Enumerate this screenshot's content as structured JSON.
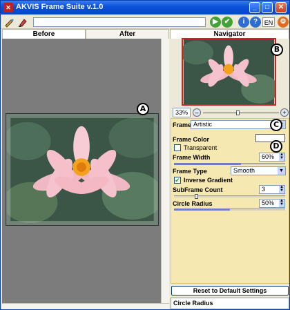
{
  "app": {
    "title": "AKVIS Frame Suite v.1.0",
    "logo_text": "✕"
  },
  "window_controls": [
    "_",
    "□",
    "✕"
  ],
  "toolbar": {
    "icons": [
      "brush-icon",
      "stamp-icon"
    ],
    "run_label": "▶",
    "apply_label": "✔",
    "info_label": "i",
    "help_label": "?",
    "language": "EN",
    "settings_label": "⚙"
  },
  "tabs": {
    "before": "Before",
    "after": "After",
    "navigator": "Navigator"
  },
  "zoom": {
    "value": "33%",
    "minus": "–",
    "plus": "+",
    "position": 0.45
  },
  "badges": {
    "a": "A",
    "b": "B",
    "c": "C",
    "d": "D"
  },
  "panel": {
    "frame_label": "Frame",
    "frame_value": "Artistic",
    "frame_color_label": "Frame Color",
    "frame_color_value": "#ffffff",
    "transparent_label": "Transparent",
    "transparent_checked": false,
    "frame_width_label": "Frame Width",
    "frame_width_value": "60%",
    "frame_width_fraction": 0.6,
    "frame_type_label": "Frame Type",
    "frame_type_value": "Smooth",
    "inverse_gradient_label": "Inverse Gradient",
    "inverse_gradient_checked": true,
    "subframe_count_label": "SubFrame Count",
    "subframe_count_value": "3",
    "subframe_fraction": 0.2,
    "circle_radius_label": "Circle Radius",
    "circle_radius_value": "50%",
    "circle_radius_fraction": 0.5
  },
  "reset_button": "Reset to Default Settings",
  "hint_text": "Circle Radius"
}
